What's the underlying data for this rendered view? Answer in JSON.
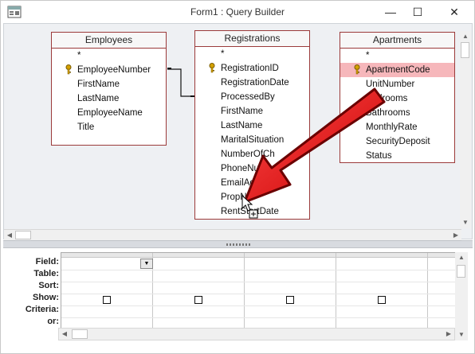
{
  "window": {
    "title": "Form1 : Query Builder"
  },
  "tables": {
    "employees": {
      "name": "Employees",
      "fields": [
        "*",
        "EmployeeNumber",
        "FirstName",
        "LastName",
        "EmployeeName",
        "Title"
      ]
    },
    "registrations": {
      "name": "Registrations",
      "fields": [
        "*",
        "RegistrationID",
        "RegistrationDate",
        "ProcessedBy",
        "FirstName",
        "LastName",
        "MaritalSituation",
        "NumberOfCh",
        "PhoneNum",
        "EmailAddress",
        "PropNbr",
        "RentStartDate"
      ]
    },
    "apartments": {
      "name": "Apartments",
      "fields": [
        "*",
        "ApartmentCode",
        "UnitNumber",
        "Bedrooms",
        "Bathrooms",
        "MonthlyRate",
        "SecurityDeposit",
        "Status"
      ]
    }
  },
  "grid": {
    "row_labels": [
      "Field:",
      "Table:",
      "Sort:",
      "Show:",
      "Criteria:",
      "or:"
    ]
  },
  "colors": {
    "arrow": "#e3141b",
    "relationship_border": "#9b3a3a",
    "highlight": "#f6b7bb"
  },
  "icons": [
    "app-icon",
    "key-icon",
    "minimize-icon",
    "maximize-icon",
    "close-icon",
    "drag-arrow",
    "cursor-icon"
  ]
}
